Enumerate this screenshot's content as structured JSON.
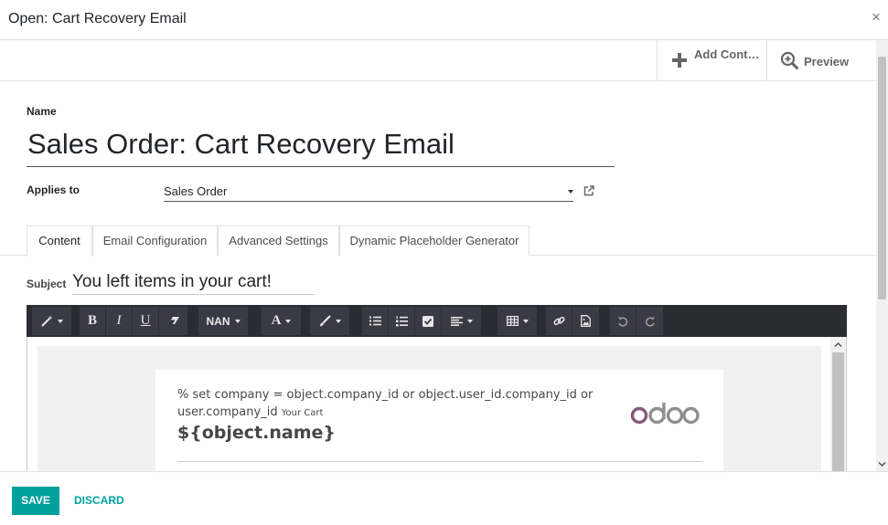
{
  "dialog": {
    "title": "Open: Cart Recovery Email",
    "close_glyph": "×"
  },
  "button_box": {
    "add_context": {
      "label": "Add Context Action",
      "icon": "plus-icon"
    },
    "preview": {
      "label": "Preview",
      "icon": "zoom-in-icon"
    }
  },
  "form": {
    "name_label": "Name",
    "name_value": "Sales Order: Cart Recovery Email",
    "applies_label": "Applies to",
    "applies_value": "Sales Order"
  },
  "tabs": [
    {
      "label": "Content",
      "active": true
    },
    {
      "label": "Email Configuration",
      "active": false
    },
    {
      "label": "Advanced Settings",
      "active": false
    },
    {
      "label": "Dynamic Placeholder Generator",
      "active": false
    }
  ],
  "subject": {
    "label": "Subject",
    "value": "You left items in your cart!"
  },
  "toolbar": {
    "font_size_label": "NAN"
  },
  "editor": {
    "line1": "% set company = object.company_id or object.user_id.company_id or",
    "line2": "user.company_id",
    "small_text": "Your Cart",
    "variable": "${object.name}",
    "logo_text": "odoo"
  },
  "footer": {
    "save_label": "SAVE",
    "discard_label": "DISCARD"
  },
  "colors": {
    "primary": "#00a09d",
    "toolbar_bg": "#2b2b33",
    "odoo_purple": "#875a7b",
    "odoo_gray": "#8f8f8f"
  }
}
